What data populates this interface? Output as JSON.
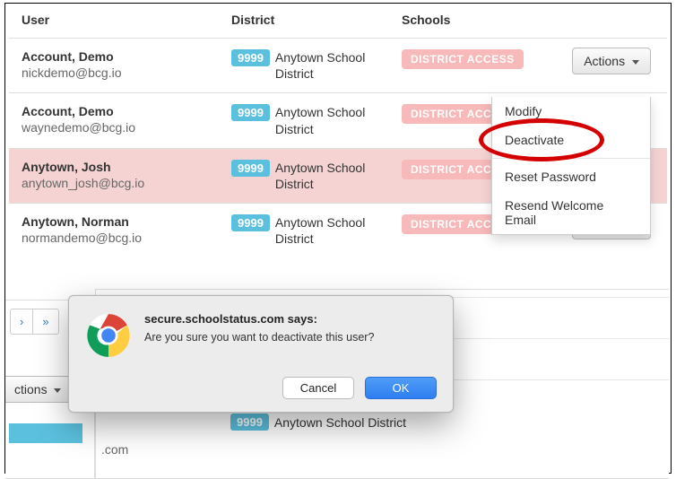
{
  "headers": {
    "user": "User",
    "district": "District",
    "schools": "Schools"
  },
  "actions_label": "Actions",
  "district_badge": "9999",
  "district_name": "Anytown School District",
  "access_badge": "DISTRICT ACCESS",
  "rows": [
    {
      "name": "Account, Demo",
      "email": "nickdemo@bcg.io",
      "pink": false,
      "show_actions": true
    },
    {
      "name": "Account, Demo",
      "email": "waynedemo@bcg.io",
      "pink": false,
      "show_actions": false
    },
    {
      "name": "Anytown, Josh",
      "email": "anytown_josh@bcg.io",
      "pink": true,
      "show_actions": false
    },
    {
      "name": "Anytown, Norman",
      "email": "normandemo@bcg.io",
      "pink": false,
      "show_actions": true
    }
  ],
  "dropdown": {
    "modify": "Modify",
    "deactivate": "Deactivate",
    "reset": "Reset Password",
    "resend": "Resend Welcome Email"
  },
  "pager": {
    "next": "›",
    "last": "»"
  },
  "lower_actions": "ctions",
  "lower_com": ".com",
  "dialog": {
    "title": "secure.schoolstatus.com says:",
    "message": "Are you sure you want to deactivate this user?",
    "cancel": "Cancel",
    "ok": "OK"
  }
}
